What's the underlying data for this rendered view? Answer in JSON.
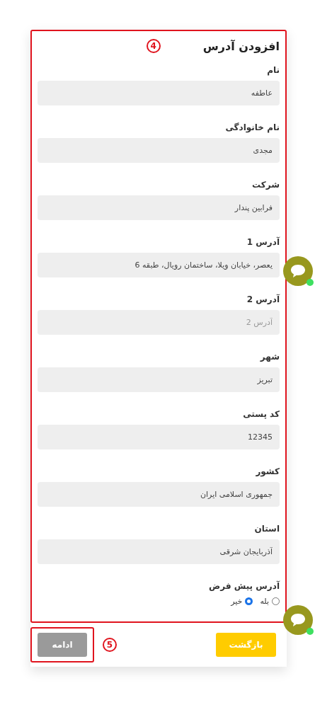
{
  "form": {
    "title": "افزودن آدرس",
    "annotation": "4",
    "fields": [
      {
        "label": "نام",
        "value": "عاطفه"
      },
      {
        "label": "نام خانوادگی",
        "value": "مجدی"
      },
      {
        "label": "شرکت",
        "value": "فرابین پندار"
      },
      {
        "label": "آدرس 1",
        "value": "یعصر، خیابان ویلا، ساختمان رویال، طبقه 6"
      },
      {
        "label": "آدرس 2",
        "placeholder": "آدرس 2"
      },
      {
        "label": "شهر",
        "value": "تبریز"
      },
      {
        "label": "کد پستی",
        "value": "12345"
      },
      {
        "label": "کشور",
        "value": "جمهوری اسلامی ایران"
      },
      {
        "label": "استان",
        "value": "آذربایجان شرقی"
      }
    ],
    "default_address": {
      "label": "آدرس پیش فرض",
      "options": [
        {
          "label": "بله",
          "selected": false
        },
        {
          "label": "خیر",
          "selected": true
        }
      ]
    }
  },
  "footer": {
    "back": "بازگشت",
    "continue": "ادامه",
    "annotation": "5"
  },
  "chat_widgets": [
    {
      "online": true
    },
    {
      "online": true
    }
  ]
}
